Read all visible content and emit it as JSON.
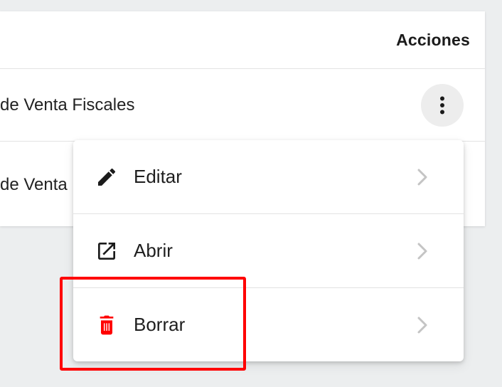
{
  "table": {
    "header": {
      "actions_label": "Acciones"
    },
    "rows": [
      {
        "label": "de Venta Fiscales"
      },
      {
        "label": "de Venta"
      }
    ]
  },
  "row_menu": {
    "items": [
      {
        "label": "Editar",
        "icon": "pencil-icon"
      },
      {
        "label": "Abrir",
        "icon": "open-in-new-icon"
      },
      {
        "label": "Borrar",
        "icon": "trash-icon"
      }
    ]
  },
  "colors": {
    "delete_accent": "#ff0000",
    "highlight": "#ff0000",
    "chevron": "#c4c4c4"
  }
}
